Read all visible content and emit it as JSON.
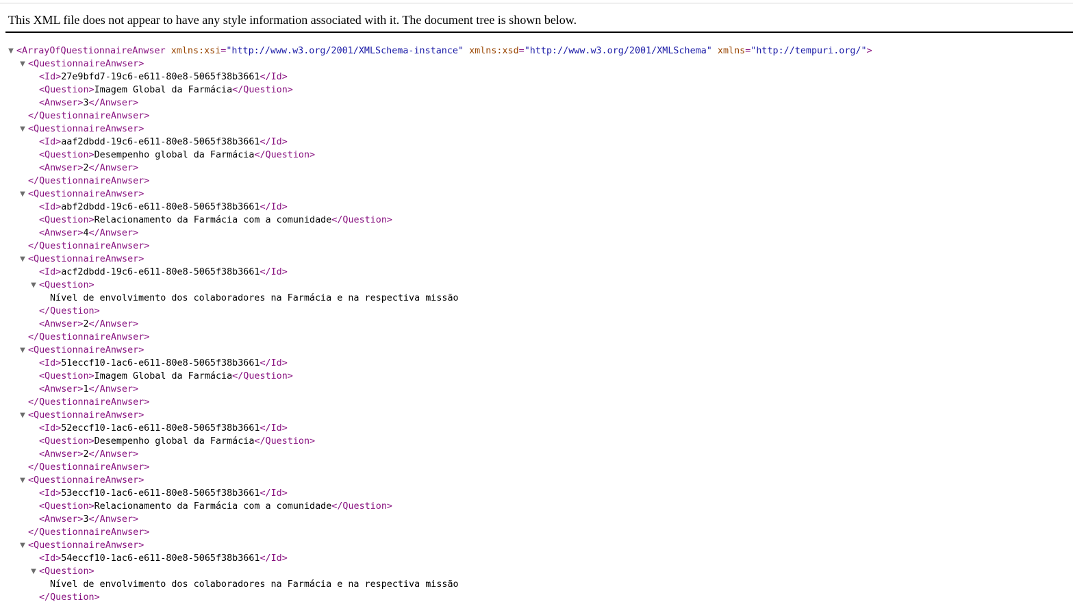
{
  "header": {
    "message": "This XML file does not appear to have any style information associated with it. The document tree is shown below."
  },
  "toggle_glyph": "▼",
  "root": {
    "open": "<ArrayOfQuestionnaireAnwser",
    "attrs": [
      {
        "name": "xmlns:xsi",
        "value": "\"http://www.w3.org/2001/XMLSchema-instance\""
      },
      {
        "name": "xmlns:xsd",
        "value": "\"http://www.w3.org/2001/XMLSchema\""
      },
      {
        "name": "xmlns",
        "value": "\"http://tempuri.org/\""
      }
    ],
    "close_bracket": ">"
  },
  "tags": {
    "qa_open": "<QuestionnaireAnwser>",
    "qa_close": "</QuestionnaireAnwser>",
    "id_open": "<Id>",
    "id_close": "</Id>",
    "question_open": "<Question>",
    "question_close": "</Question>",
    "answer_open": "<Anwser>",
    "answer_close": "</Anwser>"
  },
  "items": [
    {
      "id": "27e9bfd7-19c6-e611-80e8-5065f38b3661",
      "question": "Imagem Global da Farmácia",
      "answer": "3",
      "multiline": false
    },
    {
      "id": "aaf2dbdd-19c6-e611-80e8-5065f38b3661",
      "question": "Desempenho global da Farmácia",
      "answer": "2",
      "multiline": false
    },
    {
      "id": "abf2dbdd-19c6-e611-80e8-5065f38b3661",
      "question": "Relacionamento da Farmácia com a comunidade",
      "answer": "4",
      "multiline": false
    },
    {
      "id": "acf2dbdd-19c6-e611-80e8-5065f38b3661",
      "question": "Nível de envolvimento dos colaboradores na Farmácia e na respectiva missão",
      "answer": "2",
      "multiline": true
    },
    {
      "id": "51eccf10-1ac6-e611-80e8-5065f38b3661",
      "question": "Imagem Global da Farmácia",
      "answer": "1",
      "multiline": false
    },
    {
      "id": "52eccf10-1ac6-e611-80e8-5065f38b3661",
      "question": "Desempenho global da Farmácia",
      "answer": "2",
      "multiline": false
    },
    {
      "id": "53eccf10-1ac6-e611-80e8-5065f38b3661",
      "question": "Relacionamento da Farmácia com a comunidade",
      "answer": "3",
      "multiline": false
    },
    {
      "id": "54eccf10-1ac6-e611-80e8-5065f38b3661",
      "question": "Nível de envolvimento dos colaboradores na Farmácia e na respectiva missão",
      "answer": null,
      "multiline": true
    }
  ]
}
